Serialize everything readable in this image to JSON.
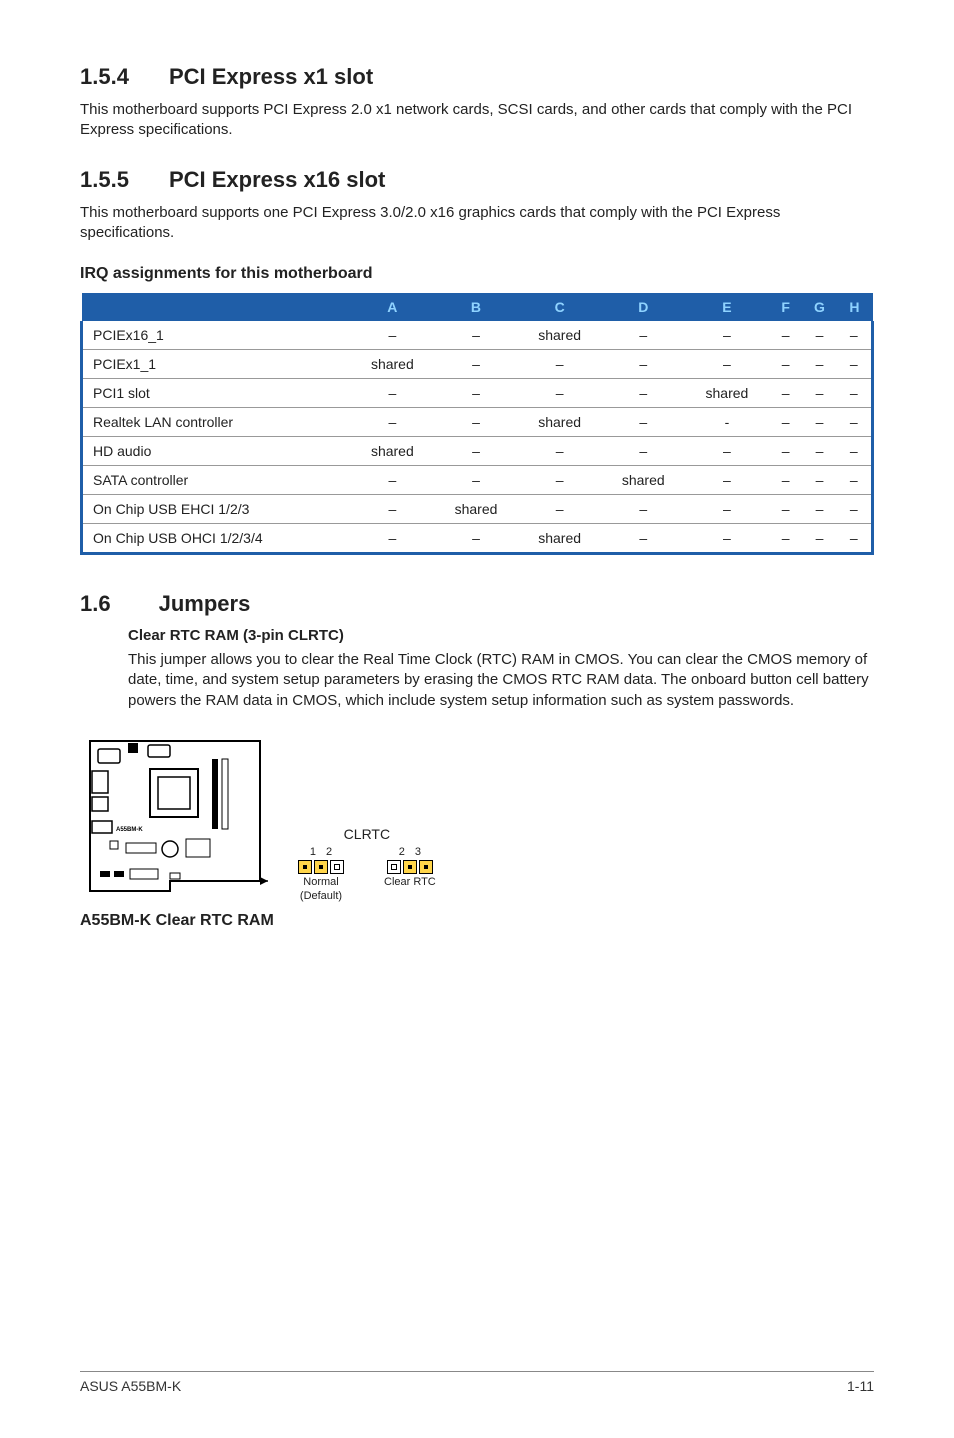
{
  "section154": {
    "num": "1.5.4",
    "title": "PCI Express x1 slot",
    "body": "This motherboard supports PCI Express 2.0 x1 network cards, SCSI cards, and other cards that comply with the PCI Express specifications."
  },
  "section155": {
    "num": "1.5.5",
    "title": "PCI Express x16 slot",
    "body": "This motherboard supports one PCI Express 3.0/2.0 x16 graphics cards that comply with the PCI Express specifications.",
    "irq_heading": "IRQ assignments for this motherboard"
  },
  "irq_table": {
    "headers": [
      "",
      "A",
      "B",
      "C",
      "D",
      "E",
      "F",
      "G",
      "H"
    ],
    "rows": [
      {
        "label": "PCIEx16_1",
        "cells": [
          "–",
          "–",
          "shared",
          "–",
          "–",
          "–",
          "–",
          "–"
        ]
      },
      {
        "label": "PCIEx1_1",
        "cells": [
          "shared",
          "–",
          "–",
          "–",
          "–",
          "–",
          "–",
          "–"
        ]
      },
      {
        "label": "PCI1 slot",
        "cells": [
          "–",
          "–",
          "–",
          "–",
          "shared",
          "–",
          "–",
          "–"
        ]
      },
      {
        "label": "Realtek LAN controller",
        "cells": [
          "–",
          "–",
          "shared",
          "–",
          "-",
          "–",
          "–",
          "–"
        ]
      },
      {
        "label": "HD audio",
        "cells": [
          "shared",
          "–",
          "–",
          "–",
          "–",
          "–",
          "–",
          "–"
        ]
      },
      {
        "label": "SATA controller",
        "cells": [
          "–",
          "–",
          "–",
          "shared",
          "–",
          "–",
          "–",
          "–"
        ]
      },
      {
        "label": "On Chip USB EHCI 1/2/3",
        "cells": [
          "–",
          "shared",
          "–",
          "–",
          "–",
          "–",
          "–",
          "–"
        ]
      },
      {
        "label": "On Chip USB OHCI 1/2/3/4",
        "cells": [
          "–",
          "–",
          "shared",
          "–",
          "–",
          "–",
          "–",
          "–"
        ]
      }
    ]
  },
  "section16": {
    "num": "1.6",
    "title": "Jumpers",
    "subtitle": "Clear RTC RAM (3-pin CLRTC)",
    "body": "This jumper allows you to clear the Real Time Clock (RTC) RAM in CMOS. You can clear the CMOS memory of date, time, and system setup parameters by erasing the CMOS RTC RAM data. The onboard button cell battery powers the RAM data in CMOS, which include system setup information such as system passwords."
  },
  "diagram": {
    "clrtc_label": "CLRTC",
    "pin_left_nums": [
      "1",
      "2"
    ],
    "pin_right_nums": [
      "2",
      "3"
    ],
    "normal_label": "Normal",
    "default_label": "(Default)",
    "clear_label": "Clear RTC",
    "caption": "A55BM-K Clear RTC RAM",
    "board_badge": "A55BM-K"
  },
  "footer": {
    "left": "ASUS A55BM-K",
    "right": "1-11"
  }
}
